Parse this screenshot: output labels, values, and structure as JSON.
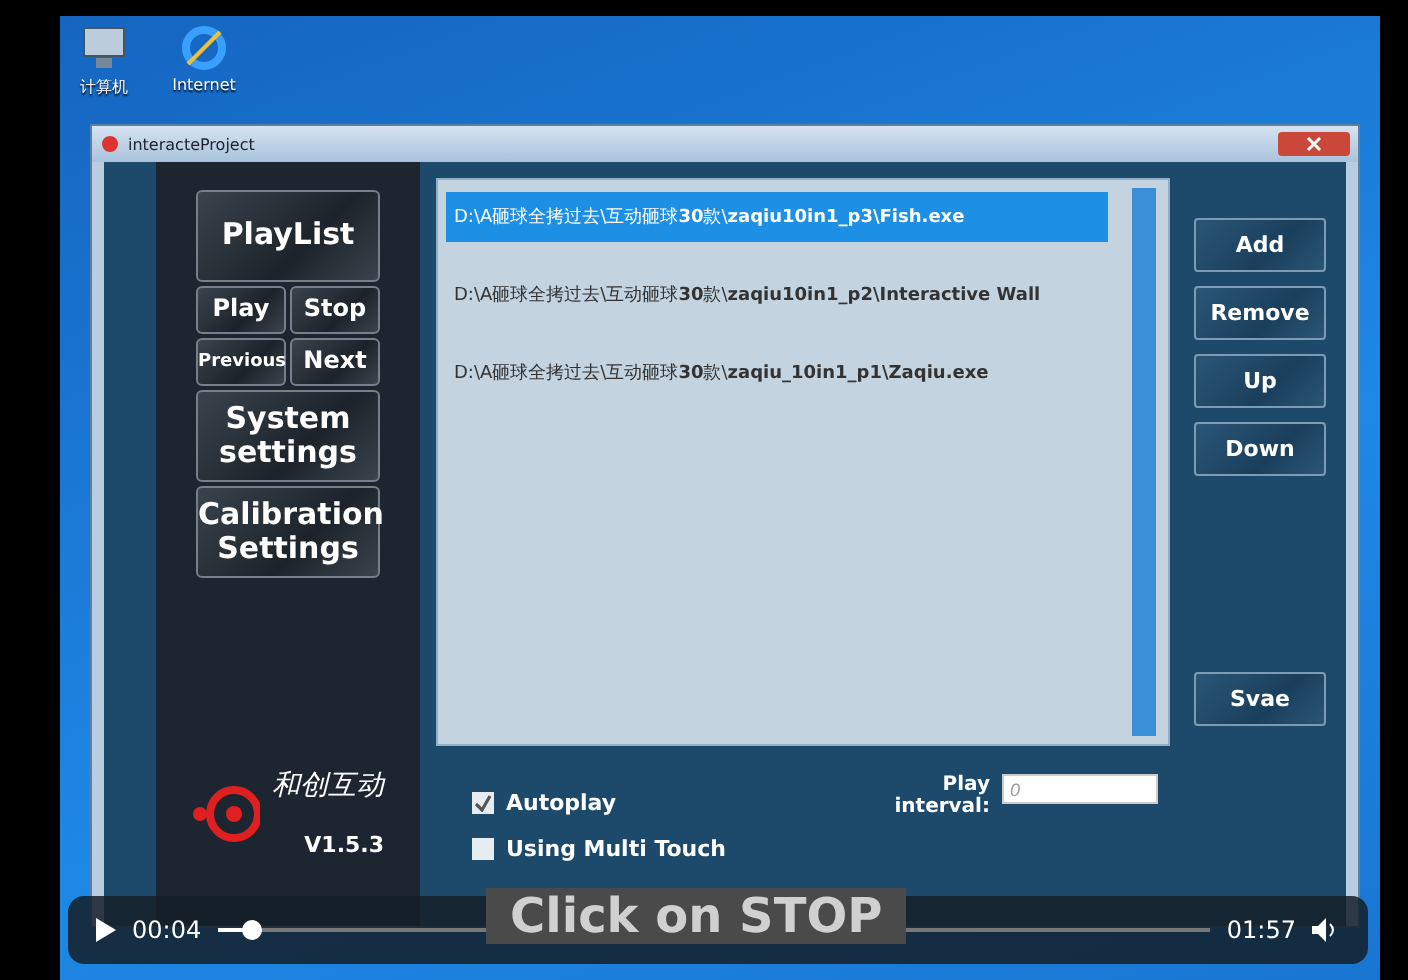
{
  "desktop": {
    "icons": [
      {
        "label": "计算机",
        "kind": "computer"
      },
      {
        "label": "Internet",
        "kind": "browser"
      }
    ]
  },
  "window": {
    "title": "interacteProject",
    "sidebar": {
      "rows": [
        {
          "buttons": [
            "PlayList"
          ],
          "kind": "big"
        },
        {
          "buttons": [
            "Play",
            "Stop"
          ],
          "kind": "small"
        },
        {
          "buttons": [
            "Previous",
            "Next"
          ],
          "kind": "small"
        },
        {
          "buttons": [
            "System settings"
          ],
          "kind": "big"
        },
        {
          "buttons": [
            "Calibration Settings"
          ],
          "kind": "big"
        }
      ],
      "logo": {
        "brand": "和创互动",
        "version": "V1.5.3"
      }
    },
    "playlist": [
      {
        "path": "D:\\A砸球全拷过去\\互动砸球**30**款\\**zaqiu10in1_p3\\Fish.exe**",
        "selected": true
      },
      {
        "path": "D:\\A砸球全拷过去\\互动砸球**30**款\\**zaqiu10in1_p2\\Interactive Wall**",
        "selected": false
      },
      {
        "path": "D:\\A砸球全拷过去\\互动砸球**30**款\\**zaqiu_10in1_p1\\Zaqiu.exe**",
        "selected": false
      }
    ],
    "actions": [
      "Add",
      "Remove",
      "Up",
      "Down"
    ],
    "save": "Svae",
    "options": [
      {
        "label": "Autoplay",
        "checked": true
      },
      {
        "label": "Using Multi Touch",
        "checked": false
      }
    ],
    "interval": {
      "label": "Play interval:",
      "placeholder": "0"
    }
  },
  "player": {
    "elapsed": "00:04",
    "total": "01:57",
    "level": 0.035,
    "caption": "Click on STOP"
  }
}
